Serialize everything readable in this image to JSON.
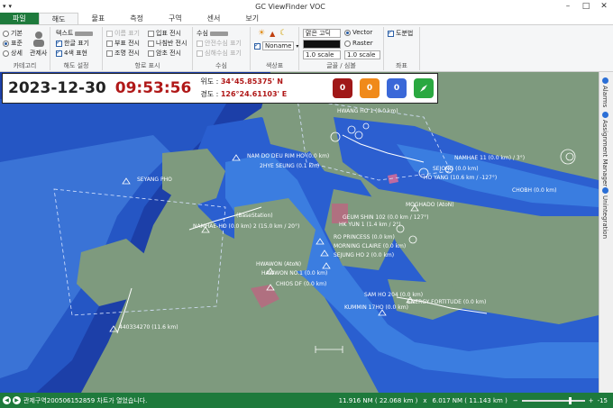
{
  "app": {
    "title": "GC ViewFinder VOC"
  },
  "tabs": [
    "파일",
    "해도",
    "물표",
    "측정",
    "구역",
    "센서",
    "보기"
  ],
  "ribbon": {
    "category": {
      "basic": "기본",
      "standard": "표준",
      "detail": "상세",
      "manager": "관제사",
      "group": "카테고리"
    },
    "chart_settings": {
      "text": "텍스트",
      "korean": "한글 표기",
      "fourcolor": "4색 표현",
      "group": "해도 설정"
    },
    "route_display": {
      "name": "이름 표기",
      "buoy": "부표 전시",
      "light": "조명 전시",
      "entry": "입표 전시",
      "spiral": "나침반 전시",
      "reef": "암초 전시",
      "group": "항로 표시"
    },
    "depth": {
      "depth": "수심",
      "safe": "안전수심 표기",
      "deep": "심해수심 표기",
      "group": "수심"
    },
    "color": {
      "palette": "Noname",
      "group": "색상표"
    },
    "font": {
      "font": "맑은 고딕",
      "vector": "Vector",
      "raster": "Raster",
      "scale1": "1.0 scale",
      "scale2": "1.0 scale",
      "group": "글꼴 / 심볼"
    },
    "coords": {
      "grid": "도분법",
      "group": "좌표"
    }
  },
  "overlay": {
    "date": "2023-12-30",
    "time": "09:53:56",
    "lat_label": "위도 :",
    "lat": "34°45.85375' N",
    "lon_label": "경도 :",
    "lon": "126°24.61103' E",
    "counters": [
      "0",
      "0",
      "0"
    ],
    "colors": {
      "red": "#a01818",
      "orange": "#f08a1a",
      "blue": "#3a68d8",
      "green": "#2aa840"
    }
  },
  "map_labels": {
    "l1": "SEYANG PHO",
    "l2": "NAM DO  DEU RIM HO (0.0 km)",
    "l3": "2HYE SEUNG (0.1 km)",
    "l4": "NAMHAE 11 (0.0 km) / 3°)",
    "l5": "HO YANG (10.6 km / -127°)",
    "l6": "SEJONG (0.0 km)",
    "l7": "MOGHADO (AtoN)",
    "l8": "(BaseStation)",
    "l9": "NAMHAE-HO (0.0 km)   2 (15.0 km / 20°)",
    "l10": "GEUM SHIN 102 (0.0 km / 127°)",
    "l11": "HK YUN 1 (1.4 km / 2°)",
    "l12": "RO PRINCESS (0.0 km)",
    "l13": "MORNING CLAIRE (0.0 km)",
    "l14": "SEJUNG HO 2 (0.0 km)",
    "l15": "HWAWON (AtoN)",
    "l16": "HAWWON NO.1 (0.0 km)",
    "l17": "CHIOS DF (0.0 km)",
    "l18": "SAM HO 204 (0.0 km)",
    "l19": "KUMMIN 17HO (0.0 km)",
    "l20": "ENERGY FORTITUDE (0.0 km)",
    "l21": "440334270 (11.6 km)",
    "l22": "HWANG HO 1 (0.0 km)",
    "l23": "CHOBH (0.0 km)"
  },
  "side_panels": [
    "Alarms",
    "Assignment Manager",
    "Unintegration"
  ],
  "status": {
    "message": "관제구역200506152859 차트가 열었습니다.",
    "nm_width": "11.916 NM ( 22.068 km )",
    "x": "x",
    "nm_height": "6.017 NM ( 11.143 km )",
    "zoom": "-15"
  }
}
